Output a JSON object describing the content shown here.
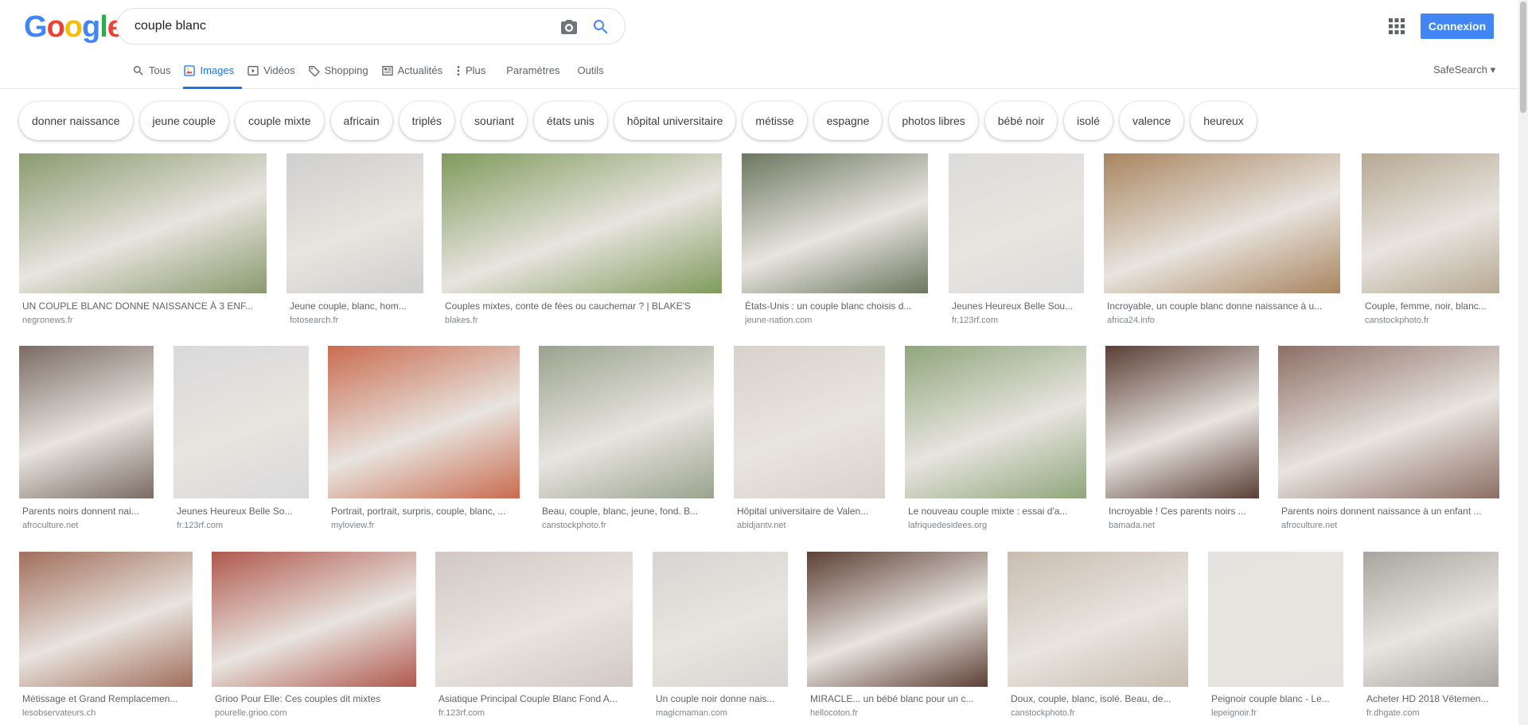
{
  "search": {
    "query": "couple blanc"
  },
  "header": {
    "connexion_label": "Connexion",
    "safesearch_label": "SafeSearch"
  },
  "tabs": [
    {
      "label": "Tous",
      "icon": "search-icon"
    },
    {
      "label": "Images",
      "icon": "image-icon"
    },
    {
      "label": "Vidéos",
      "icon": "video-icon"
    },
    {
      "label": "Shopping",
      "icon": "tag-icon"
    },
    {
      "label": "Actualités",
      "icon": "news-icon"
    },
    {
      "label": "Plus",
      "icon": "more-vert-icon"
    },
    {
      "label": "Paramètres",
      "icon": ""
    },
    {
      "label": "Outils",
      "icon": ""
    }
  ],
  "chips": [
    "donner naissance",
    "jeune couple",
    "couple mixte",
    "africain",
    "triplés",
    "souriant",
    "états unis",
    "hôpital universitaire",
    "métisse",
    "espagne",
    "photos libres",
    "bébé noir",
    "isolé",
    "valence",
    "heureux"
  ],
  "results": [
    {
      "title": "UN COUPLE BLANC DONNE NAISSANCE À 3 ENF...",
      "source": "negronews.fr",
      "color": "#8a9a6e"
    },
    {
      "title": "Jeune couple, blanc, hom...",
      "source": "fotosearch.fr",
      "color": "#cfcfcf"
    },
    {
      "title": "Couples mixtes, conte de fées ou cauchemar ? | BLAKE'S",
      "source": "blakes.fr",
      "color": "#7f9b5c"
    },
    {
      "title": "États-Unis : un couple blanc choisis d...",
      "source": "jeune-nation.com",
      "color": "#6b7760"
    },
    {
      "title": "Jeunes Heureux Belle Sou...",
      "source": "fr.123rf.com",
      "color": "#dcdcdc"
    },
    {
      "title": "Incroyable, un couple blanc donne naissance à u...",
      "source": "africa24.info",
      "color": "#a9855f"
    },
    {
      "title": "Couple, femme, noir, blanc...",
      "source": "canstockphoto.fr",
      "color": "#b7a993"
    },
    {
      "title": "Parents noirs donnent nai...",
      "source": "afroculture.net",
      "color": "#7a6b63"
    },
    {
      "title": "Jeunes Heureux Belle So...",
      "source": "fr.123rf.com",
      "color": "#d9d9dc"
    },
    {
      "title": "Portrait, portrait, surpris, couple, blanc, ...",
      "source": "myloview.fr",
      "color": "#c96c4f"
    },
    {
      "title": "Beau, couple, blanc, jeune, fond. B...",
      "source": "canstockphoto.fr",
      "color": "#9aa38e"
    },
    {
      "title": "Hôpital universitaire de Valen...",
      "source": "abidjantv.net",
      "color": "#d8d2cc"
    },
    {
      "title": "Le nouveau couple mixte : essai d'a...",
      "source": "lafriquedesidees.org",
      "color": "#8fa67c"
    },
    {
      "title": "Incroyable ! Ces parents noirs ...",
      "source": "bamada.net",
      "color": "#5a3f36"
    },
    {
      "title": "Parents noirs donnent naissance à un enfant ...",
      "source": "afroculture.net",
      "color": "#8d6f66"
    },
    {
      "title": "Métissage et Grand Remplacemen...",
      "source": "lesobservateurs.ch",
      "color": "#a26e5b"
    },
    {
      "title": "Grioo Pour Elle: Ces couples dit mixtes",
      "source": "pourelle.grioo.com",
      "color": "#b0584d"
    },
    {
      "title": "Asiatique Principal Couple Blanc Fond A...",
      "source": "fr.123rf.com",
      "color": "#d2c8c4"
    },
    {
      "title": "Un couple noir donne nais...",
      "source": "magicmaman.com",
      "color": "#d7d4d2"
    },
    {
      "title": "MIRACLE... un bébé blanc pour un c...",
      "source": "hellocoton.fr",
      "color": "#5d4036"
    },
    {
      "title": "Doux, couple, blanc, isolé. Beau, de...",
      "source": "canstockphoto.fr",
      "color": "#c9bdb0"
    },
    {
      "title": "Peignoir couple blanc - Le...",
      "source": "lepeignoir.fr",
      "color": "#e6e2df"
    },
    {
      "title": "Acheter HD 2018 Vêtemen...",
      "source": "fr.dhgate.com",
      "color": "#a8a59f"
    }
  ]
}
